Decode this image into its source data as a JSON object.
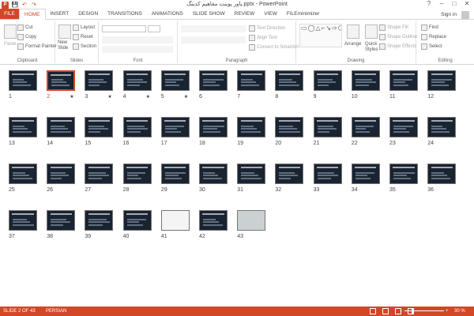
{
  "window": {
    "title": "پاور پوینت مفاهیم کدینگ.pptx - PowerPoint",
    "min": "–",
    "max": "□",
    "close": "✕",
    "help": "?"
  },
  "qat": {
    "logo": "P",
    "save": "💾",
    "undo": "↶",
    "redo": "↷"
  },
  "tabs": [
    "FILE",
    "HOME",
    "INSERT",
    "DESIGN",
    "TRANSITIONS",
    "ANIMATIONS",
    "SLIDE SHOW",
    "REVIEW",
    "VIEW",
    "FILEminimizer"
  ],
  "active_tab": "HOME",
  "account": {
    "sign_in": "Sign in"
  },
  "ribbon": {
    "clipboard": {
      "label": "Clipboard",
      "paste": "Paste",
      "cut": "Cut",
      "copy": "Copy",
      "format_painter": "Format Painter"
    },
    "slides": {
      "label": "Slides",
      "new_slide": "New",
      "new_slide2": "Slide",
      "layout": "Layout",
      "reset": "Reset",
      "section": "Section"
    },
    "font": {
      "label": "Font"
    },
    "paragraph": {
      "label": "Paragraph",
      "text_direction": "Text Direction",
      "align_text": "Align Text",
      "smartart": "Convert to SmartArt"
    },
    "drawing": {
      "label": "Drawing",
      "shapes_glyphs": "▭◯△⌐↘⇨⬠☆◇▱⬭⌒↔⤷{}",
      "arrange": "Arrange",
      "quick_styles": "Quick",
      "quick_styles2": "Styles",
      "shape_fill": "Shape Fill",
      "shape_outline": "Shape Outline",
      "shape_effects": "Shape Effects"
    },
    "editing": {
      "label": "Editing",
      "find": "Find",
      "replace": "Replace",
      "select": "Select"
    }
  },
  "slides": [
    {
      "n": "1",
      "star": ""
    },
    {
      "n": "2",
      "star": "★"
    },
    {
      "n": "3",
      "star": "★"
    },
    {
      "n": "4",
      "star": "★"
    },
    {
      "n": "5",
      "star": "★"
    },
    {
      "n": "6",
      "star": ""
    },
    {
      "n": "7",
      "star": ""
    },
    {
      "n": "8",
      "star": ""
    },
    {
      "n": "9",
      "star": ""
    },
    {
      "n": "10",
      "star": ""
    },
    {
      "n": "11",
      "star": ""
    },
    {
      "n": "12",
      "star": ""
    },
    {
      "n": "13",
      "star": ""
    },
    {
      "n": "14",
      "star": ""
    },
    {
      "n": "15",
      "star": ""
    },
    {
      "n": "16",
      "star": ""
    },
    {
      "n": "17",
      "star": ""
    },
    {
      "n": "18",
      "star": ""
    },
    {
      "n": "19",
      "star": ""
    },
    {
      "n": "20",
      "star": ""
    },
    {
      "n": "21",
      "star": ""
    },
    {
      "n": "22",
      "star": ""
    },
    {
      "n": "23",
      "star": ""
    },
    {
      "n": "24",
      "star": ""
    },
    {
      "n": "25",
      "star": ""
    },
    {
      "n": "26",
      "star": ""
    },
    {
      "n": "27",
      "star": ""
    },
    {
      "n": "28",
      "star": ""
    },
    {
      "n": "29",
      "star": ""
    },
    {
      "n": "30",
      "star": ""
    },
    {
      "n": "31",
      "star": ""
    },
    {
      "n": "32",
      "star": ""
    },
    {
      "n": "33",
      "star": ""
    },
    {
      "n": "34",
      "star": ""
    },
    {
      "n": "35",
      "star": ""
    },
    {
      "n": "36",
      "star": ""
    },
    {
      "n": "37",
      "star": ""
    },
    {
      "n": "38",
      "star": ""
    },
    {
      "n": "39",
      "star": ""
    },
    {
      "n": "40",
      "star": ""
    },
    {
      "n": "41",
      "star": ""
    },
    {
      "n": "42",
      "star": ""
    },
    {
      "n": "43",
      "star": ""
    }
  ],
  "selected_slide": "2",
  "status": {
    "slide": "SLIDE 2 OF 43",
    "language": "PERSIAN",
    "zoom": "30 %",
    "zoom_minus": "–",
    "zoom_plus": "+"
  },
  "colors": {
    "accent": "#d24726"
  }
}
